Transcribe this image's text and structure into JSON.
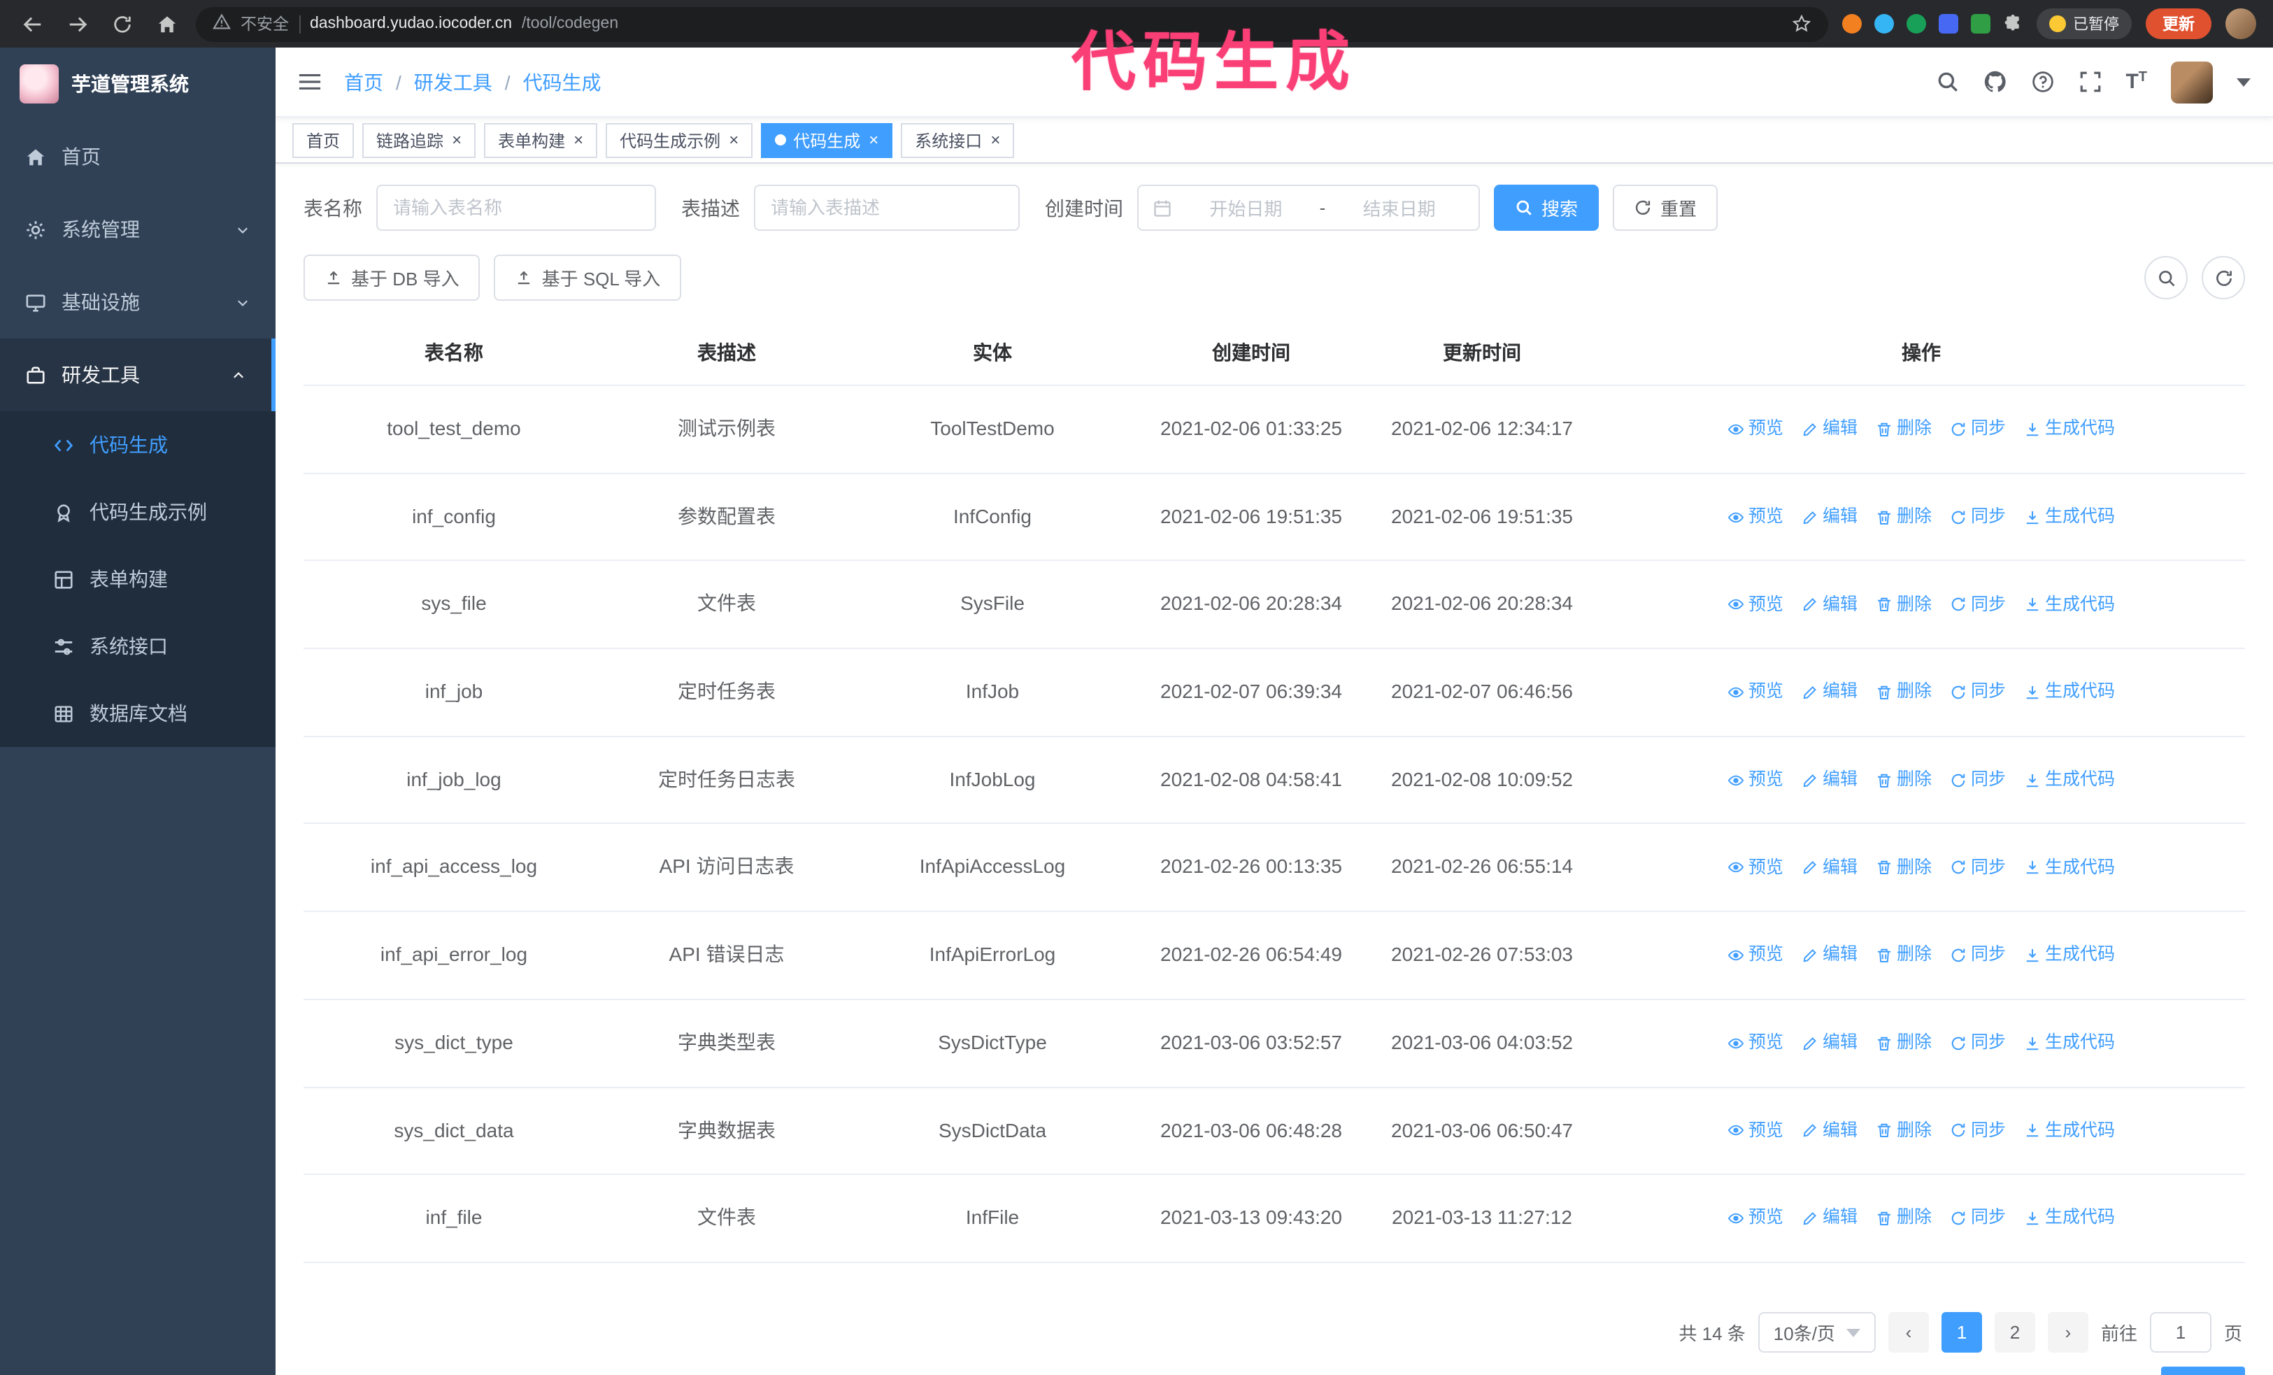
{
  "accent_color": "#409eff",
  "annotation": {
    "text": "代码生成"
  },
  "browser": {
    "security_label": "不安全",
    "url_host": "dashboard.yudao.iocoder.cn",
    "url_path": "/tool/codegen",
    "paused_badge": "已暂停",
    "update_button": "更新"
  },
  "sidebar": {
    "logo_title": "芋道管理系统",
    "items": [
      {
        "key": "home",
        "label": "首页",
        "icon": "home-icon",
        "expandable": false,
        "expanded": false
      },
      {
        "key": "system",
        "label": "系统管理",
        "icon": "gear-icon",
        "expandable": true,
        "expanded": false
      },
      {
        "key": "infra",
        "label": "基础设施",
        "icon": "monitor-icon",
        "expandable": true,
        "expanded": false
      },
      {
        "key": "devtools",
        "label": "研发工具",
        "icon": "briefcase-icon",
        "expandable": true,
        "expanded": true
      }
    ],
    "sub_items": [
      {
        "key": "codegen",
        "label": "代码生成",
        "icon": "code-icon",
        "active": true
      },
      {
        "key": "codegen-example",
        "label": "代码生成示例",
        "icon": "badge-icon",
        "active": false
      },
      {
        "key": "form-builder",
        "label": "表单构建",
        "icon": "form-icon",
        "active": false
      },
      {
        "key": "system-api",
        "label": "系统接口",
        "icon": "sliders-icon",
        "active": false
      },
      {
        "key": "db-doc",
        "label": "数据库文档",
        "icon": "grid-icon",
        "active": false
      }
    ]
  },
  "header": {
    "breadcrumb": [
      "首页",
      "研发工具",
      "代码生成"
    ]
  },
  "tabs": [
    {
      "key": "home",
      "label": "首页",
      "closable": false,
      "active": false
    },
    {
      "key": "trace",
      "label": "链路追踪",
      "closable": true,
      "active": false
    },
    {
      "key": "form-builder",
      "label": "表单构建",
      "closable": true,
      "active": false
    },
    {
      "key": "codegen-example",
      "label": "代码生成示例",
      "closable": true,
      "active": false
    },
    {
      "key": "codegen",
      "label": "代码生成",
      "closable": true,
      "active": true
    },
    {
      "key": "system-api",
      "label": "系统接口",
      "closable": true,
      "active": false
    }
  ],
  "filters": {
    "table_name_label": "表名称",
    "table_name_placeholder": "请输入表名称",
    "table_desc_label": "表描述",
    "table_desc_placeholder": "请输入表描述",
    "create_time_label": "创建时间",
    "date_start_placeholder": "开始日期",
    "date_separator": "-",
    "date_end_placeholder": "结束日期",
    "search_button": "搜索",
    "reset_button": "重置"
  },
  "toolbar": {
    "import_db": "基于 DB 导入",
    "import_sql": "基于 SQL 导入"
  },
  "table": {
    "columns": [
      "表名称",
      "表描述",
      "实体",
      "创建时间",
      "更新时间",
      "操作"
    ],
    "actions": [
      "预览",
      "编辑",
      "删除",
      "同步",
      "生成代码"
    ],
    "rows": [
      {
        "name": "tool_test_demo",
        "desc": "测试示例表",
        "entity": "ToolTestDemo",
        "created": "2021-02-06 01:33:25",
        "updated": "2021-02-06 12:34:17"
      },
      {
        "name": "inf_config",
        "desc": "参数配置表",
        "entity": "InfConfig",
        "created": "2021-02-06 19:51:35",
        "updated": "2021-02-06 19:51:35"
      },
      {
        "name": "sys_file",
        "desc": "文件表",
        "entity": "SysFile",
        "created": "2021-02-06 20:28:34",
        "updated": "2021-02-06 20:28:34"
      },
      {
        "name": "inf_job",
        "desc": "定时任务表",
        "entity": "InfJob",
        "created": "2021-02-07 06:39:34",
        "updated": "2021-02-07 06:46:56"
      },
      {
        "name": "inf_job_log",
        "desc": "定时任务日志表",
        "entity": "InfJobLog",
        "created": "2021-02-08 04:58:41",
        "updated": "2021-02-08 10:09:52"
      },
      {
        "name": "inf_api_access_log",
        "desc": "API 访问日志表",
        "entity": "InfApiAccessLog",
        "created": "2021-02-26 00:13:35",
        "updated": "2021-02-26 06:55:14"
      },
      {
        "name": "inf_api_error_log",
        "desc": "API 错误日志",
        "entity": "InfApiErrorLog",
        "created": "2021-02-26 06:54:49",
        "updated": "2021-02-26 07:53:03"
      },
      {
        "name": "sys_dict_type",
        "desc": "字典类型表",
        "entity": "SysDictType",
        "created": "2021-03-06 03:52:57",
        "updated": "2021-03-06 04:03:52"
      },
      {
        "name": "sys_dict_data",
        "desc": "字典数据表",
        "entity": "SysDictData",
        "created": "2021-03-06 06:48:28",
        "updated": "2021-03-06 06:50:47"
      },
      {
        "name": "inf_file",
        "desc": "文件表",
        "entity": "InfFile",
        "created": "2021-03-13 09:43:20",
        "updated": "2021-03-13 11:27:12"
      }
    ]
  },
  "pagination": {
    "total": "共 14 条",
    "page_size": "10条/页",
    "pages": [
      "1",
      "2"
    ],
    "active_page": "1",
    "goto_label": "前往",
    "goto_value": "1",
    "goto_suffix": "页"
  }
}
